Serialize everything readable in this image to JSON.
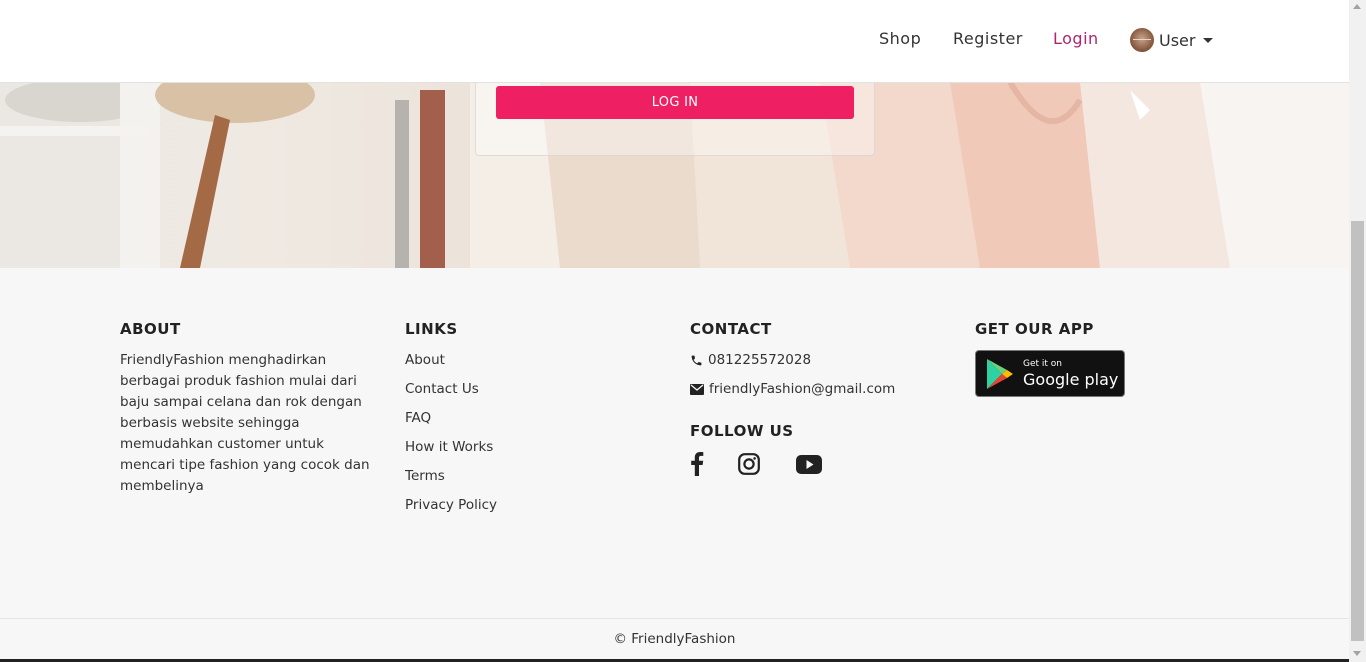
{
  "navbar": {
    "links": [
      {
        "label": "Shop"
      },
      {
        "label": "Register"
      },
      {
        "label": "Login"
      }
    ],
    "user_label": "User"
  },
  "login_form": {
    "submit_label": "LOG IN"
  },
  "footer": {
    "about": {
      "title": "ABOUT",
      "text": "FriendlyFashion menghadirkan berbagai produk fashion mulai dari baju sampai celana dan rok dengan berbasis website sehingga memudahkan customer untuk mencari tipe fashion yang cocok dan membelinya"
    },
    "links": {
      "title": "LINKS",
      "items": [
        "About",
        "Contact Us",
        "FAQ",
        "How it Works",
        "Terms",
        "Privacy Policy"
      ]
    },
    "contact": {
      "title": "CONTACT",
      "phone": "081225572028",
      "email": "friendlyFashion@gmail.com"
    },
    "follow": {
      "title": "FOLLOW US",
      "icons": [
        "facebook-icon",
        "instagram-icon",
        "youtube-icon"
      ]
    },
    "app": {
      "title": "GET OUR APP",
      "badge_small": "Get it on",
      "badge_big": "Google play"
    },
    "copyright": "© FriendlyFashion"
  },
  "colors": {
    "accent": "#ee1f63",
    "active_link": "#b0246e",
    "footer_bg": "#f7f7f7"
  }
}
